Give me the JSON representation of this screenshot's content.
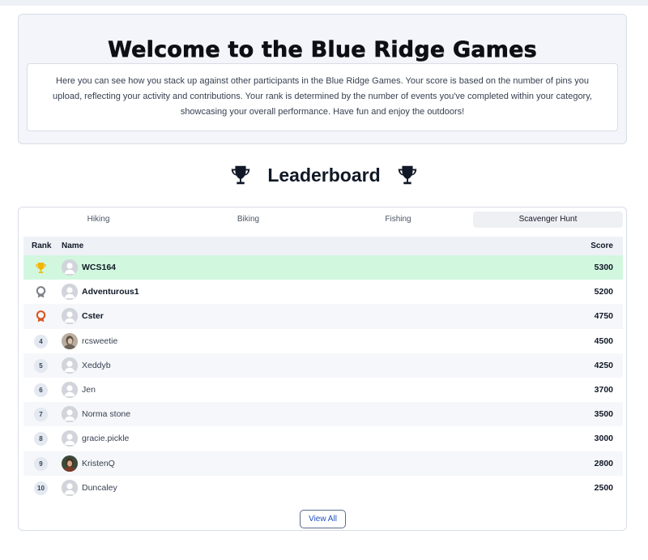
{
  "welcome": {
    "title": "Welcome to the Blue Ridge Games",
    "description": "Here you can see how you stack up against other participants in the Blue Ridge Games. Your score is based on the number of pins you upload, reflecting your activity and contributions. Your rank is determined by the number of events you've completed within your category, showcasing your overall performance. Have fun and enjoy the outdoors!"
  },
  "leaderboard": {
    "title": "Leaderboard",
    "icons": [
      "trophy-icon",
      "trophy-icon"
    ],
    "tabs": [
      {
        "label": "Hiking",
        "active": false
      },
      {
        "label": "Biking",
        "active": false
      },
      {
        "label": "Fishing",
        "active": false
      },
      {
        "label": "Scavenger Hunt",
        "active": true
      }
    ],
    "columns": {
      "rank": "Rank",
      "name": "Name",
      "score": "Score"
    },
    "rows": [
      {
        "rank": "1",
        "rank_icon": "gold-trophy-icon",
        "name": "WCS164",
        "score": "5300",
        "avatar": "default-avatar-icon"
      },
      {
        "rank": "2",
        "rank_icon": "silver-medal-icon",
        "name": "Adventurous1",
        "score": "5200",
        "avatar": "default-avatar-icon"
      },
      {
        "rank": "3",
        "rank_icon": "bronze-medal-icon",
        "name": "Cster",
        "score": "4750",
        "avatar": "default-avatar-icon"
      },
      {
        "rank": "4",
        "rank_icon": "",
        "name": "rcsweetie",
        "score": "4500",
        "avatar": "photo-avatar"
      },
      {
        "rank": "5",
        "rank_icon": "",
        "name": "Xeddyb",
        "score": "4250",
        "avatar": "default-avatar-icon"
      },
      {
        "rank": "6",
        "rank_icon": "",
        "name": "Jen",
        "score": "3700",
        "avatar": "default-avatar-icon"
      },
      {
        "rank": "7",
        "rank_icon": "",
        "name": "Norma stone",
        "score": "3500",
        "avatar": "default-avatar-icon"
      },
      {
        "rank": "8",
        "rank_icon": "",
        "name": "gracie.pickle",
        "score": "3000",
        "avatar": "default-avatar-icon"
      },
      {
        "rank": "9",
        "rank_icon": "",
        "name": "KristenQ",
        "score": "2800",
        "avatar": "photo-avatar"
      },
      {
        "rank": "10",
        "rank_icon": "",
        "name": "Duncaley",
        "score": "2500",
        "avatar": "default-avatar-icon"
      }
    ],
    "view_all": "View All"
  },
  "colors": {
    "highlight_row": "#d1f7df",
    "gold": "#f4b400",
    "silver": "#7b8087",
    "bronze": "#d9531e",
    "button_text": "#1f4fbf"
  }
}
